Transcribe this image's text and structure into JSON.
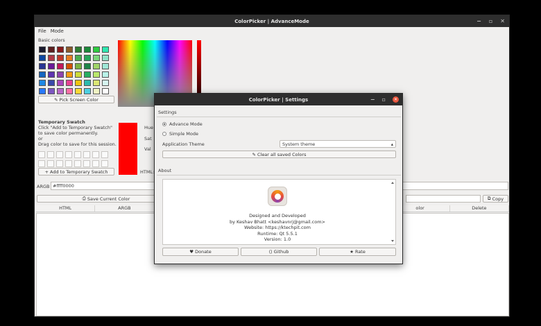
{
  "main_window": {
    "title": "ColorPicker | AdvanceMode",
    "controls": [
      "−",
      "▫",
      "✕"
    ],
    "menu": [
      "File",
      "Mode"
    ],
    "basic_colors_label": "Basic colors",
    "basic_colors": [
      "#1a1a2e",
      "#5e1f1f",
      "#8b1a1a",
      "#8b5a2b",
      "#2e7d32",
      "#1b8a3a",
      "#2ecc40",
      "#2ee8b0",
      "#0d47a1",
      "#b23a48",
      "#c0392b",
      "#e67e22",
      "#4caf50",
      "#26a65b",
      "#7bd67b",
      "#8fe3c8",
      "#283593",
      "#6a1b9a",
      "#c2185b",
      "#d35400",
      "#7cb342",
      "#1e8449",
      "#a0d468",
      "#9fe8d8",
      "#1565c0",
      "#5e35b1",
      "#8e44ad",
      "#f39c12",
      "#cddc39",
      "#27ae60",
      "#b9e86b",
      "#b9f2e8",
      "#1e88e5",
      "#3949ab",
      "#ab47bc",
      "#e84393",
      "#f1c40f",
      "#2bbbad",
      "#dce775",
      "#d6f5f0",
      "#2979ff",
      "#7e57c2",
      "#ba68c8",
      "#ff6fa6",
      "#fdd835",
      "#4dd0e1",
      "#f0f4c3",
      "#ffffff"
    ],
    "pick_screen_label": "Pick Screen Color",
    "temp_swatch_title": "Temporary Swatch",
    "temp_swatch_lines": [
      "Click \"Add to Temporary Swatch\"",
      "to save color permanently.",
      "or",
      "Drag color to save for this session."
    ],
    "add_temp_label": "+ Add to Temporary Swatch",
    "hue_label": "Hue",
    "sat_label": "Sat",
    "val_label": "Val",
    "html_label": "HTML:",
    "argb_label": "ARGB",
    "argb_value": "#ffff0000",
    "save_current_label": "Save Current Color",
    "copy_label": "Copy",
    "table_headers": [
      "HTML",
      "ARGB",
      "",
      "",
      "",
      "",
      "olor",
      "Delete"
    ],
    "current_color": "#ff0000"
  },
  "settings_dialog": {
    "title": "ColorPicker | Settings",
    "controls": [
      "−",
      "▫",
      "✕"
    ],
    "settings_header": "Settings",
    "mode_advance": "Advance Mode",
    "mode_simple": "Simple Mode",
    "theme_label": "Application Theme",
    "theme_value": "System theme",
    "clear_label": "Clear all saved Colors",
    "about_header": "About",
    "about_lines": [
      "Designed and Developed",
      "by Keshav Bhatt <keshavnrj@gmail.com>",
      "Website: https://ktechpit.com",
      "Runtime: Qt 5.5.1",
      "Version: 1.0"
    ],
    "donate_label": "Donate",
    "github_label": "Github",
    "rate_label": "Rate"
  }
}
